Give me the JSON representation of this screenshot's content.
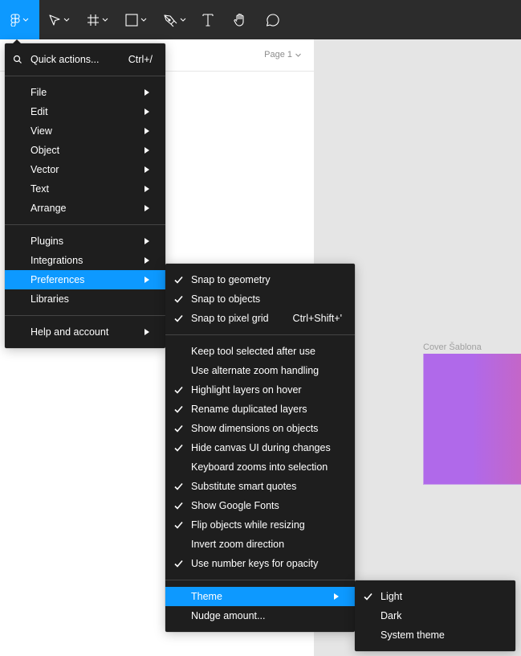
{
  "toolbar": {
    "tools": [
      {
        "name": "main-menu",
        "icon": "figma-logo-icon",
        "active": true,
        "has_dropdown": true
      },
      {
        "name": "move",
        "icon": "move-arrow-icon",
        "has_dropdown": true
      },
      {
        "name": "frame",
        "icon": "frame-hash-icon",
        "has_dropdown": true
      },
      {
        "name": "shape",
        "icon": "rectangle-icon",
        "has_dropdown": true
      },
      {
        "name": "pen",
        "icon": "pen-nib-icon",
        "has_dropdown": true
      },
      {
        "name": "text",
        "icon": "text-t-icon",
        "has_dropdown": false
      },
      {
        "name": "hand",
        "icon": "hand-icon",
        "has_dropdown": false
      },
      {
        "name": "comment",
        "icon": "comment-bubble-icon",
        "has_dropdown": false
      }
    ],
    "accent_color": "#0d99ff",
    "background_color": "#2c2c2c"
  },
  "left_panel": {
    "page_selector": "Page 1"
  },
  "canvas": {
    "frame_label": "Cover Šablona",
    "frame_gradient": [
      "#b069ea",
      "#c466c8"
    ]
  },
  "main_menu": {
    "quick_actions": {
      "label": "Quick actions...",
      "shortcut": "Ctrl+/"
    },
    "groups": [
      [
        {
          "label": "File",
          "submenu": true
        },
        {
          "label": "Edit",
          "submenu": true
        },
        {
          "label": "View",
          "submenu": true
        },
        {
          "label": "Object",
          "submenu": true
        },
        {
          "label": "Vector",
          "submenu": true
        },
        {
          "label": "Text",
          "submenu": true
        },
        {
          "label": "Arrange",
          "submenu": true
        }
      ],
      [
        {
          "label": "Plugins",
          "submenu": true
        },
        {
          "label": "Integrations",
          "submenu": true
        },
        {
          "label": "Preferences",
          "submenu": true,
          "active": true
        },
        {
          "label": "Libraries",
          "submenu": false
        }
      ],
      [
        {
          "label": "Help and account",
          "submenu": true
        }
      ]
    ]
  },
  "preferences_menu": {
    "snap": [
      {
        "label": "Snap to geometry",
        "checked": true
      },
      {
        "label": "Snap to objects",
        "checked": true
      },
      {
        "label": "Snap to pixel grid",
        "checked": true,
        "shortcut": "Ctrl+Shift+'"
      }
    ],
    "options": [
      {
        "label": "Keep tool selected after use",
        "checked": false
      },
      {
        "label": "Use alternate zoom handling",
        "checked": false
      },
      {
        "label": "Highlight layers on hover",
        "checked": true
      },
      {
        "label": "Rename duplicated layers",
        "checked": true
      },
      {
        "label": "Show dimensions on objects",
        "checked": true
      },
      {
        "label": "Hide canvas UI during changes",
        "checked": true
      },
      {
        "label": "Keyboard zooms into selection",
        "checked": false
      },
      {
        "label": "Substitute smart quotes",
        "checked": true
      },
      {
        "label": "Show Google Fonts",
        "checked": true
      },
      {
        "label": "Flip objects while resizing",
        "checked": true
      },
      {
        "label": "Invert zoom direction",
        "checked": false
      },
      {
        "label": "Use number keys for opacity",
        "checked": true
      }
    ],
    "bottom": [
      {
        "label": "Theme",
        "submenu": true,
        "active": true
      },
      {
        "label": "Nudge amount...",
        "submenu": false
      }
    ]
  },
  "theme_menu": {
    "items": [
      {
        "label": "Light",
        "checked": true
      },
      {
        "label": "Dark",
        "checked": false
      },
      {
        "label": "System theme",
        "checked": false
      }
    ]
  }
}
